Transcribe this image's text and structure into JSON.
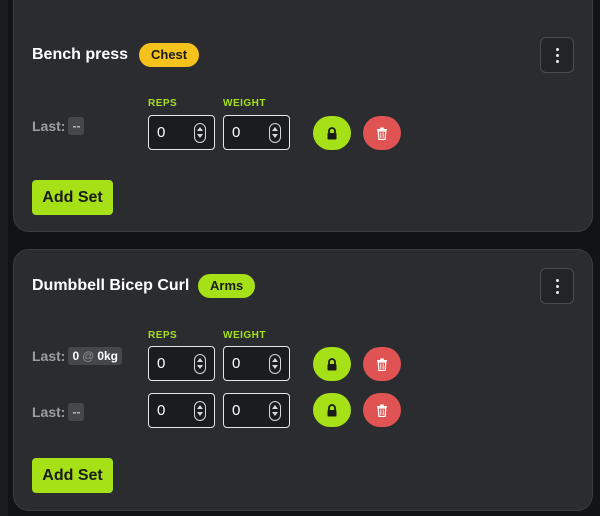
{
  "exercises": [
    {
      "title": "Bench press",
      "tag": "Chest",
      "columns": {
        "reps": "REPS",
        "weight": "WEIGHT"
      },
      "sets": [
        {
          "last_label": "Last:",
          "last_value": "--",
          "reps": "0",
          "weight": "0"
        }
      ],
      "add_set_label": "Add Set"
    },
    {
      "title": "Dumbbell Bicep Curl",
      "tag": "Arms",
      "columns": {
        "reps": "REPS",
        "weight": "WEIGHT"
      },
      "sets": [
        {
          "last_label": "Last:",
          "last_reps": "0",
          "last_at": "@",
          "last_weight": "0kg",
          "reps": "0",
          "weight": "0"
        },
        {
          "last_label": "Last:",
          "last_value": "--",
          "reps": "0",
          "weight": "0"
        }
      ],
      "add_set_label": "Add Set"
    }
  ],
  "icons": {
    "menu": "more-vertical-icon",
    "lock": "lock-icon",
    "delete": "trash-icon",
    "stepper": "stepper-icon"
  },
  "colors": {
    "accent": "#a6e017",
    "chest_tag": "#f4c21a",
    "delete": "#e05353",
    "card": "#2a2c2f",
    "background": "#121315"
  }
}
